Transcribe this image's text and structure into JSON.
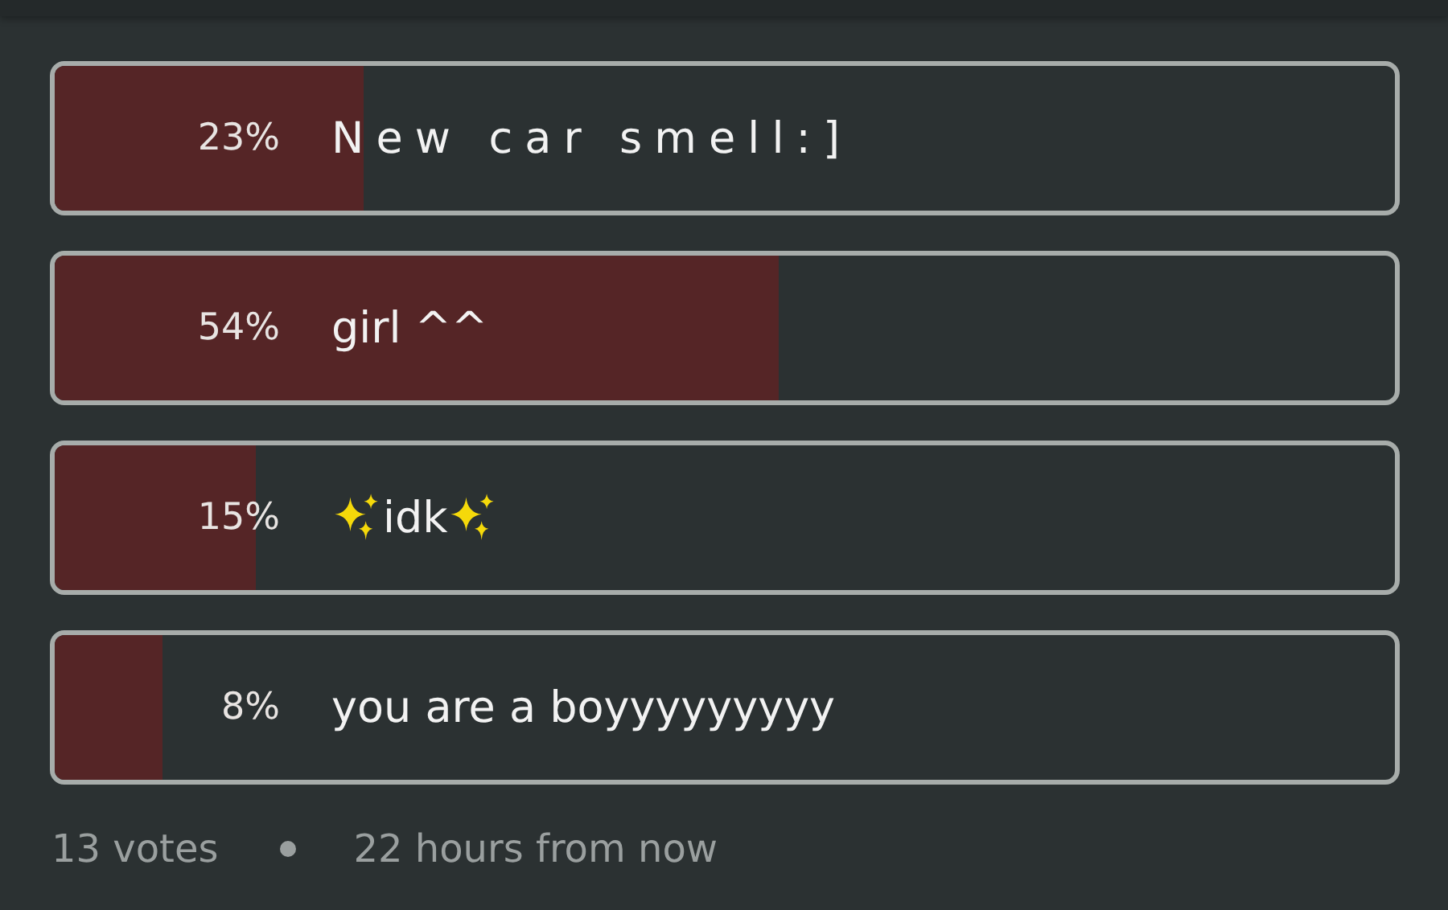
{
  "options": [
    {
      "percent": "23%",
      "label": "New car smell:]",
      "level": 0.23,
      "spaced": true,
      "sparkles": false
    },
    {
      "percent": "54%",
      "label": "girl ^^",
      "level": 0.54,
      "spaced": false,
      "sparkles": false
    },
    {
      "percent": "15%",
      "label": "idk",
      "level": 0.15,
      "spaced": false,
      "sparkles": true
    },
    {
      "percent": "8%",
      "label": "you are a boyyyyyyyyy",
      "level": 0.08,
      "spaced": false,
      "sparkles": false
    }
  ],
  "footer": {
    "votes": "13 votes",
    "time": "22 hours from now"
  }
}
